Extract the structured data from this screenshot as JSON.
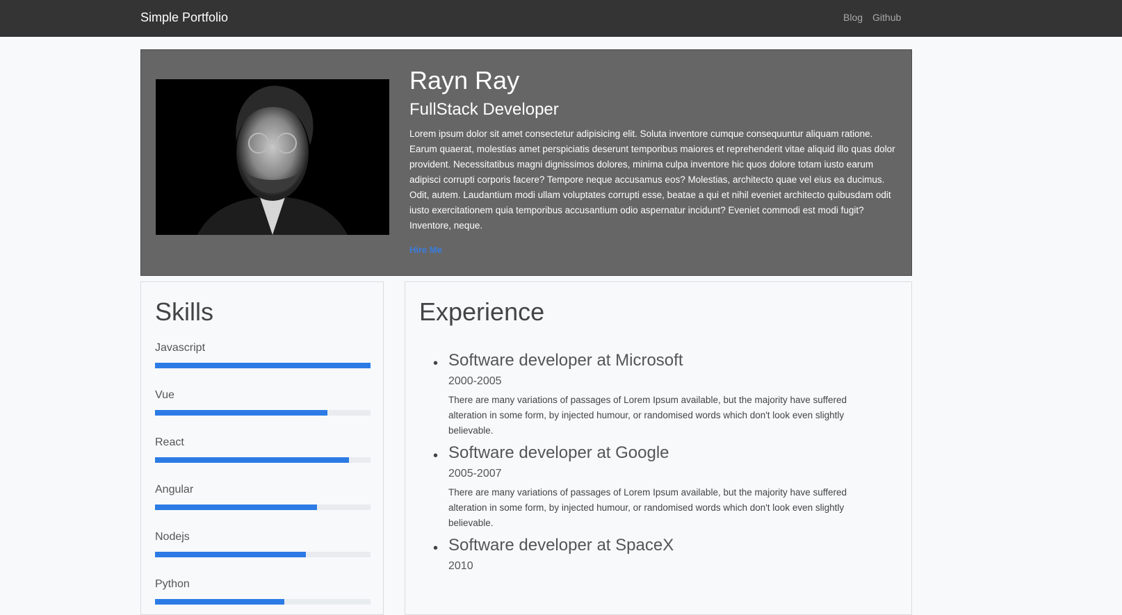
{
  "navbar": {
    "brand": "Simple Portfolio",
    "links": [
      "Blog",
      "Github"
    ]
  },
  "hero": {
    "photo_alt": "profile-photo",
    "name": "Rayn Ray",
    "role": "FullStack Developer",
    "bio": "Lorem ipsum dolor sit amet consectetur adipisicing elit. Soluta inventore cumque consequuntur aliquam ratione. Earum quaerat, molestias amet perspiciatis deserunt temporibus maiores et reprehenderit vitae aliquid illo quas dolor provident. Necessitatibus magni dignissimos dolores, minima culpa inventore hic quos dolore totam iusto earum adipisci corrupti corporis facere? Tempore neque accusamus eos? Molestias, architecto quae vel eius ea ducimus. Odit, autem. Laudantium modi ullam voluptates corrupti esse, beatae a qui et nihil eveniet architecto quibusdam odit iusto exercitationem quia temporibus accusantium odio aspernatur incidunt? Eveniet commodi est modi fugit? Inventore, neque.",
    "hire_label": "Hire Me"
  },
  "skills": {
    "title": "Skills",
    "items": [
      {
        "name": "Javascript",
        "level": 1.0
      },
      {
        "name": "Vue",
        "level": 0.8
      },
      {
        "name": "React",
        "level": 0.9
      },
      {
        "name": "Angular",
        "level": 0.75
      },
      {
        "name": "Nodejs",
        "level": 0.7
      },
      {
        "name": "Python",
        "level": 0.6
      }
    ]
  },
  "experience": {
    "title": "Experience",
    "items": [
      {
        "title": "Software developer at Microsoft",
        "years": "2000-2005",
        "desc": "There are many variations of passages of Lorem Ipsum available, but the majority have suffered alteration in some form, by injected humour, or randomised words which don't look even slightly believable."
      },
      {
        "title": "Software developer at Google",
        "years": "2005-2007",
        "desc": "There are many variations of passages of Lorem Ipsum available, but the majority have suffered alteration in some form, by injected humour, or randomised words which don't look even slightly believable."
      },
      {
        "title": "Software developer at SpaceX",
        "years": "2010",
        "desc": ""
      }
    ]
  },
  "colors": {
    "navbar": "#343434",
    "hero": "#666666",
    "accent": "#2c7be5",
    "bar_track": "#e9ecef"
  }
}
